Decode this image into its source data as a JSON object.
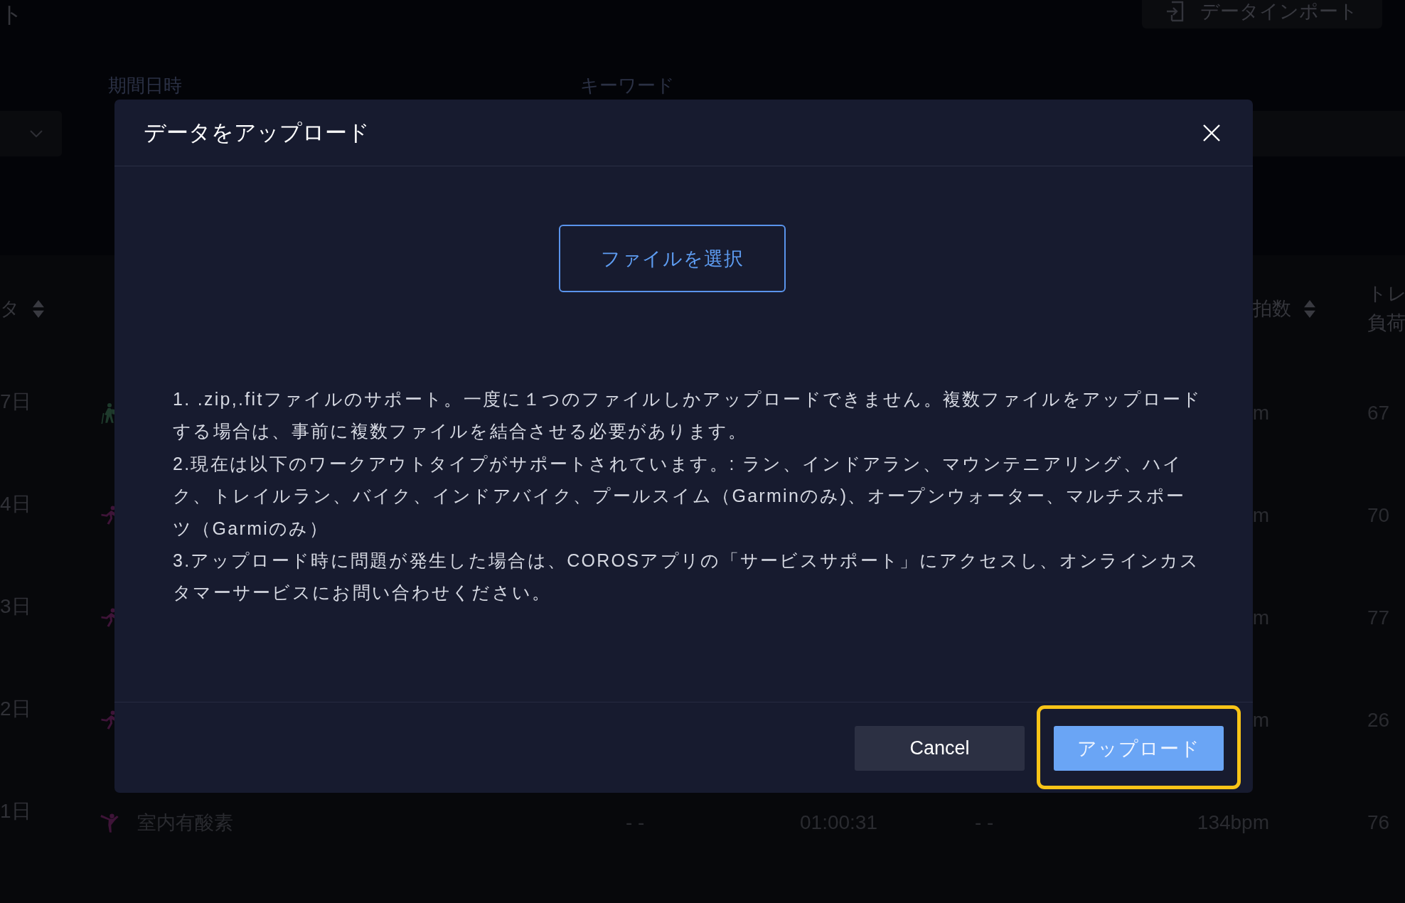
{
  "page": {
    "title": "ト",
    "import_button": {
      "label": "データインポート"
    }
  },
  "filters": [
    {
      "label": "期間日時"
    },
    {
      "label": "キーワード"
    }
  ],
  "table": {
    "columns": [
      {
        "label_lines": [
          "タ"
        ],
        "sortable": true
      },
      {
        "label_lines": [
          "拍数"
        ],
        "sortable": true
      },
      {
        "label_lines": [
          "トレ",
          "負荷"
        ],
        "sortable": false
      }
    ],
    "rows": [
      {
        "date": "7日",
        "sport": {
          "kind": "hiking",
          "color": "#1e3a2c"
        },
        "heart_rate": "m",
        "training_load": "67"
      },
      {
        "date": "4日",
        "sport": {
          "kind": "running",
          "color": "#3e1438"
        },
        "heart_rate": "m",
        "training_load": "70"
      },
      {
        "date": "3日",
        "sport": {
          "kind": "running",
          "color": "#3e1438"
        },
        "heart_rate": "m",
        "training_load": "77"
      },
      {
        "date": "2日",
        "sport": {
          "kind": "running",
          "color": "#3e1438"
        },
        "heart_rate": "m",
        "training_load": "26"
      },
      {
        "date": "1日",
        "sport": {
          "kind": "indoor",
          "color": "#3e1438"
        },
        "activity": "室内有酸素",
        "column_4": "- -",
        "column_5": "01:00:31",
        "column_6": "- -",
        "heart_rate": "134bpm",
        "training_load": "76"
      }
    ]
  },
  "dialog": {
    "title": "データをアップロード",
    "select_file_button": {
      "label": "ファイルを選択"
    },
    "instructions": [
      "1. .zip,.fitファイルのサポート。一度に１つのファイルしかアップロードできません。複数ファイルをアップロードする場合は、事前に複数ファイルを結合させる必要があります。",
      "2.現在は以下のワークアウトタイプがサポートされています。: ラン、インドアラン、マウンテニアリング、ハイク、トレイルラン、バイク、インドアバイク、プールスイム（Garminのみ)、オープンウォーター、マルチスポーツ（Garmiのみ）",
      "3.アップロード時に問題が発生した場合は、COROSアプリの「サービスサポート」にアクセスし、オンラインカスタマーサービスにお問い合わせください。"
    ],
    "buttons": [
      {
        "label": "Cancel",
        "kind": "secondary",
        "highlighted": false
      },
      {
        "label": "アップロード",
        "kind": "primary",
        "highlighted": true
      }
    ]
  }
}
